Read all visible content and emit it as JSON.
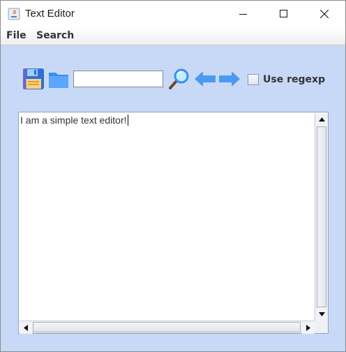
{
  "window": {
    "title": "Text Editor",
    "icons": {
      "app": "java-app-icon",
      "minimize": "minimize-icon",
      "maximize": "maximize-icon",
      "close": "close-icon"
    }
  },
  "menu": {
    "items": [
      {
        "label": "File"
      },
      {
        "label": "Search"
      }
    ]
  },
  "toolbar": {
    "icons": {
      "save": "save-floppy-icon",
      "open": "folder-icon",
      "find": "magnifier-icon",
      "prev": "arrow-left-icon",
      "next": "arrow-right-icon"
    },
    "search": {
      "value": "",
      "placeholder": ""
    },
    "regexp": {
      "label": "Use regexp",
      "checked": false
    }
  },
  "editor": {
    "text": "I am a simple text editor!"
  },
  "colors": {
    "window_bg": "#c8d9f7",
    "icon_blue": "#3f8fef",
    "save_blue": "#2f6fd8"
  }
}
